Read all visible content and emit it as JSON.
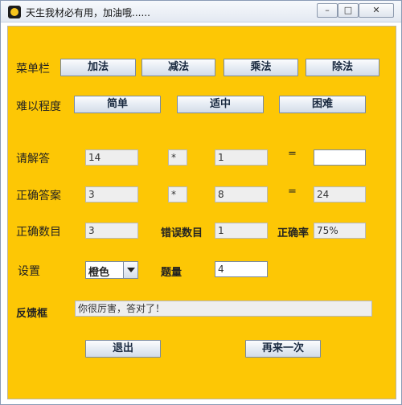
{
  "window": {
    "title": "天生我材必有用，加油哦......",
    "min": "–",
    "max": "□",
    "close": "✕"
  },
  "menu": {
    "label": "菜单栏",
    "add": "加法",
    "subtract": "减法",
    "multiply": "乘法",
    "divide": "除法"
  },
  "difficulty": {
    "label": "难以程度",
    "easy": "简单",
    "medium": "适中",
    "hard": "困难"
  },
  "question": {
    "label": "请解答",
    "operand1": "14",
    "operator": "*",
    "operand2": "1",
    "equals": "=",
    "answer": ""
  },
  "correct": {
    "label": "正确答案",
    "operand1": "3",
    "operator": "*",
    "operand2": "8",
    "equals": "=",
    "result": "24"
  },
  "stats": {
    "correct_label": "正确数目",
    "correct_count": "3",
    "wrong_label": "错误数目",
    "wrong_count": "1",
    "rate_label": "正确率",
    "rate": "75%"
  },
  "settings": {
    "label": "设置",
    "color": "橙色",
    "count_label": "题量",
    "count": "4"
  },
  "feedback": {
    "label": "反馈框",
    "text": "你很厉害，答对了！"
  },
  "actions": {
    "exit": "退出",
    "retry": "再来一次"
  },
  "colors": {
    "background": "#fdc705"
  }
}
